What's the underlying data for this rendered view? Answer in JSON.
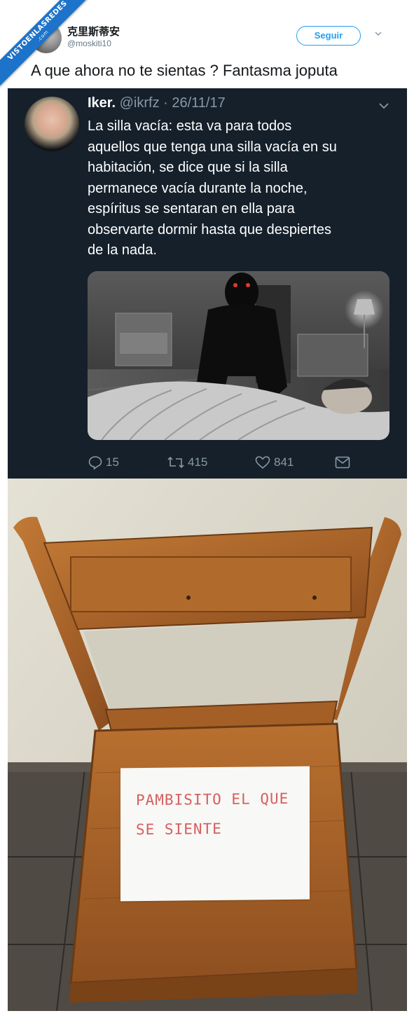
{
  "watermark": {
    "text": "VISTOENLASREDES",
    "sub": ".com"
  },
  "tweet": {
    "author_name": "克里斯蒂安",
    "author_handle": "@moskiti10",
    "follow_label": "Seguir",
    "text": "A que ahora no te sientas ? Fantasma joputa"
  },
  "quoted_tweet": {
    "author_name": "Iker.",
    "author_handle": "@ikrfz",
    "date": "· 26/11/17",
    "text_lines": [
      "La silla vacía: esta va para todos",
      "aquellos que tenga una silla vacía en su",
      "habitación, se dice que si la silla",
      "permanece vacía durante la noche,",
      "espíritus se sentaran en ella para",
      "observarte dormir hasta que despiertes",
      "de la nada."
    ],
    "replies": "15",
    "retweets": "415",
    "likes": "841"
  },
  "photo_note": {
    "line1": "PAMBISITO EL QUE",
    "line2": "SE SIENTE"
  },
  "colors": {
    "twitter_blue": "#1da1f2",
    "dark_bg": "#15202b",
    "dark_secondary": "#8899a6",
    "note_ink": "#d55f5f",
    "ribbon": "#1d73c9"
  },
  "icons": [
    "chevron-down-icon",
    "reply-icon",
    "retweet-icon",
    "like-icon",
    "direct-message-icon"
  ]
}
